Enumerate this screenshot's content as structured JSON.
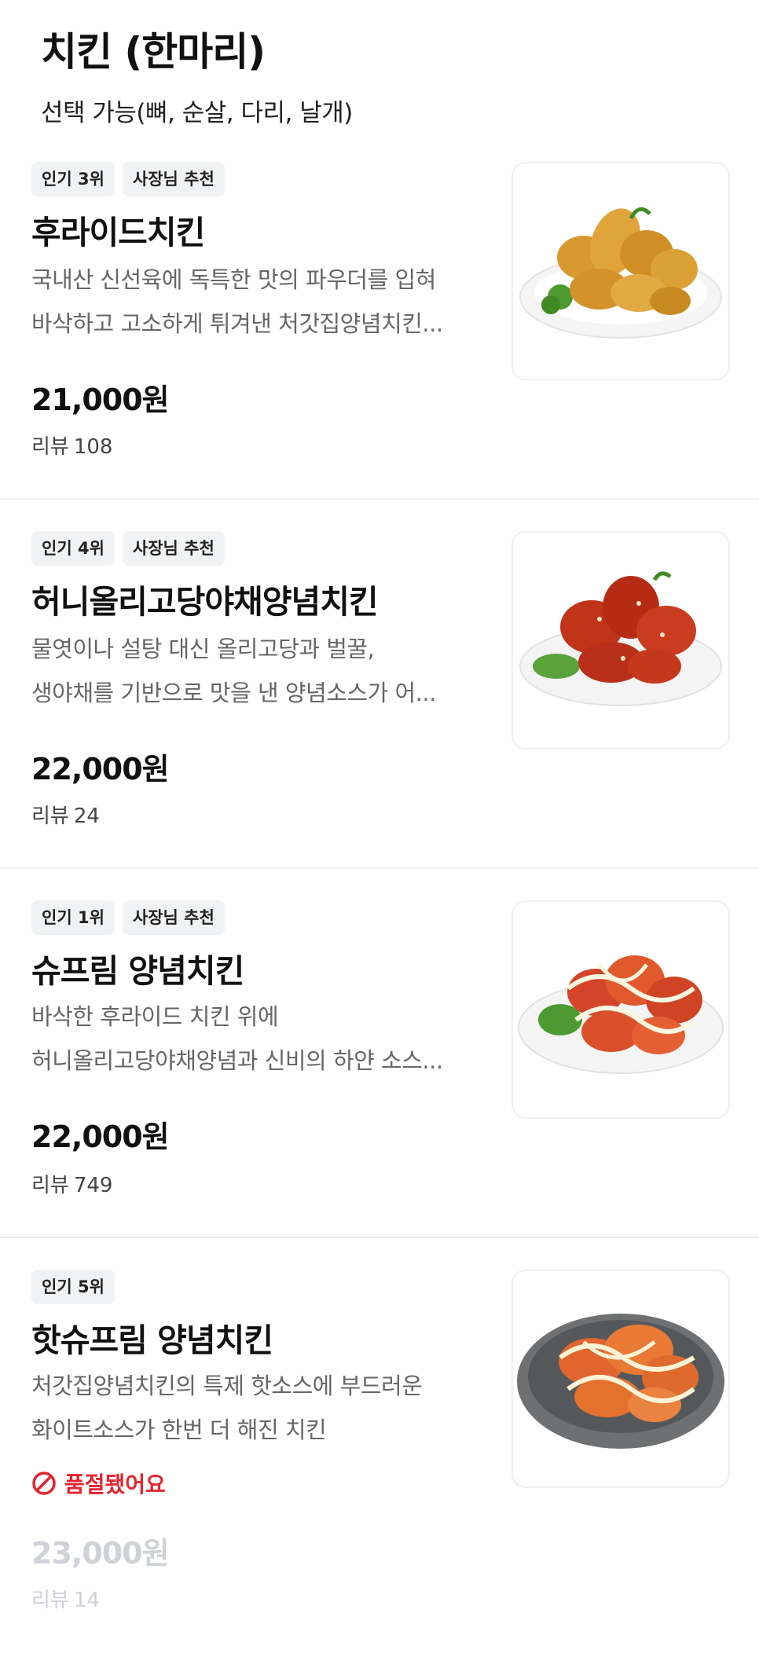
{
  "section": {
    "title": "치킨 (한마리)",
    "subtitle": "선택 가능(뼈, 순살, 다리, 날개)"
  },
  "review_label": "리뷰",
  "items": [
    {
      "tags": [
        "인기 3위",
        "사장님 추천"
      ],
      "name": "후라이드치킨",
      "desc": [
        "국내산 신선육에 독특한 맛의 파우더를 입혀",
        "바삭하고 고소하게 튀겨낸 처갓집양념치킨..."
      ],
      "price": "21,000원",
      "reviews": "108",
      "image_icon": "fried-chicken-photo"
    },
    {
      "tags": [
        "인기 4위",
        "사장님 추천"
      ],
      "name": "허니올리고당야채양념치킨",
      "desc": [
        "물엿이나 설탕 대신 올리고당과 벌꿀,",
        "생야채를 기반으로 맛을 낸 양념소스가 어..."
      ],
      "price": "22,000원",
      "reviews": "24",
      "image_icon": "yangnyeom-chicken-photo"
    },
    {
      "tags": [
        "인기 1위",
        "사장님 추천"
      ],
      "name": "슈프림 양념치킨",
      "desc": [
        "바삭한 후라이드 치킨 위에",
        "허니올리고당야채양념과 신비의 하얀 소스..."
      ],
      "price": "22,000원",
      "reviews": "749",
      "image_icon": "supreme-chicken-photo"
    },
    {
      "tags": [
        "인기 5위"
      ],
      "name": "핫슈프림 양념치킨",
      "desc": [
        "처갓집양념치킨의 특제 핫소스에 부드러운",
        "화이트소스가 한번 더 해진 치킨"
      ],
      "sold_out": "품절됐어요",
      "price": "23,000원",
      "reviews": "14",
      "image_icon": "hot-supreme-chicken-photo"
    }
  ],
  "colors": {
    "sold_out": "#e2252f",
    "tag_bg": "#f1f2f3",
    "dimmed_text": "#cfd2d6"
  }
}
